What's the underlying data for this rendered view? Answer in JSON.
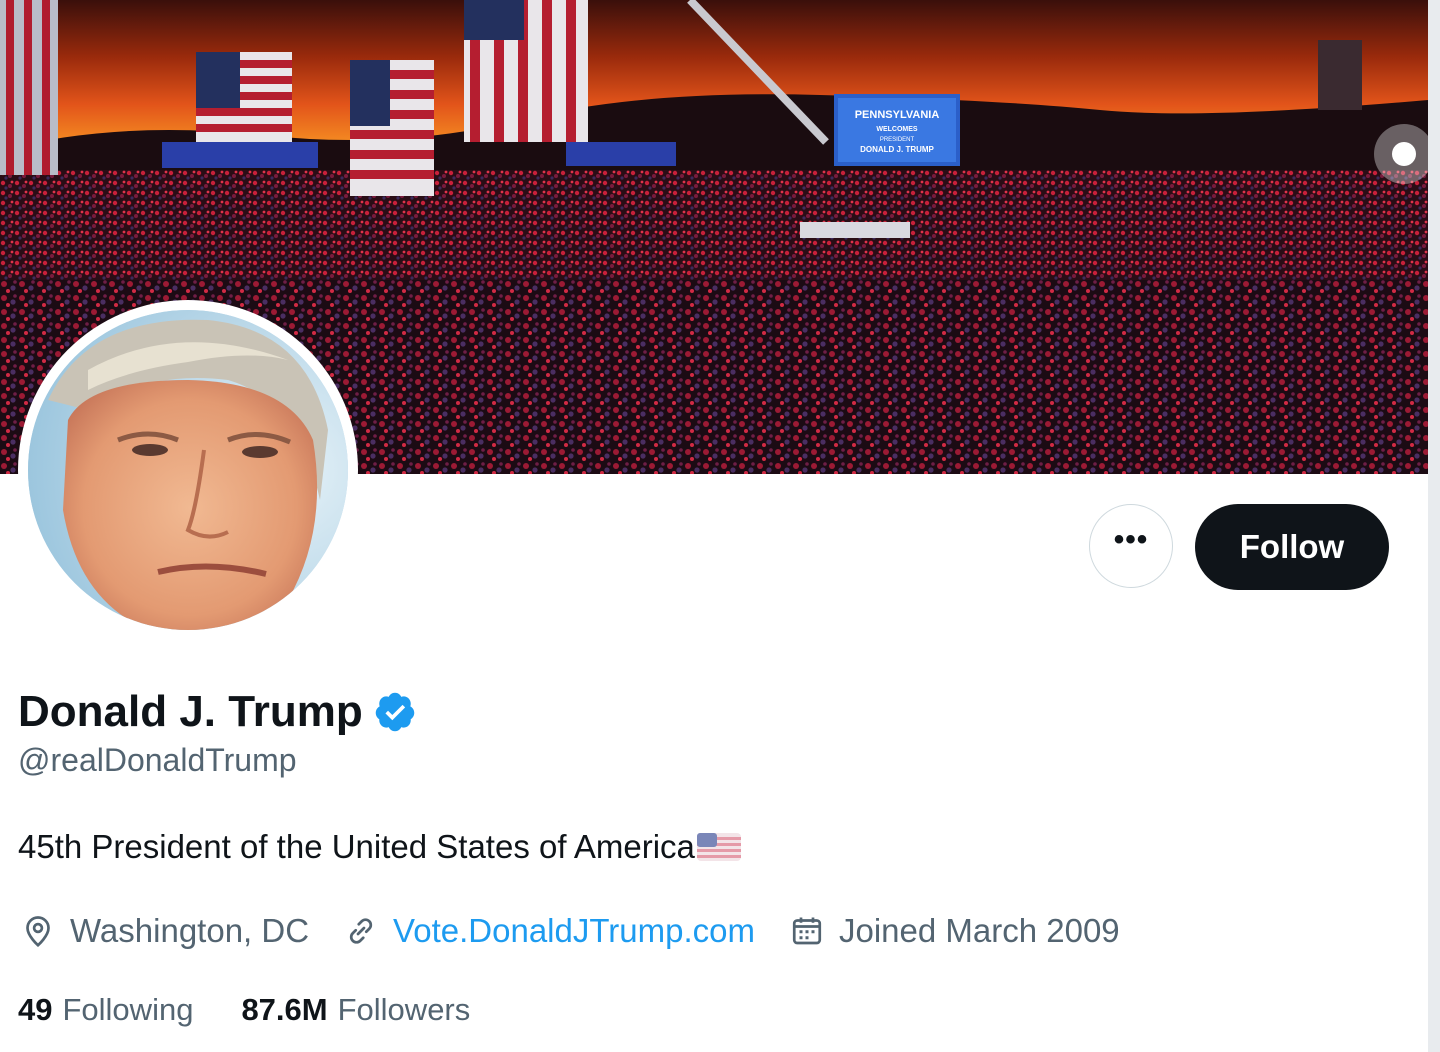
{
  "profile": {
    "display_name": "Donald J. Trump",
    "handle": "@realDonaldTrump",
    "bio": "45th President of the United States of America",
    "bio_emoji": "us-flag-emoji",
    "location": "Washington, DC",
    "website": "Vote.DonaldJTrump.com",
    "joined": "Joined March 2009",
    "verified": true
  },
  "banner": {
    "signs": [
      "PENNSYLVANIA",
      "WELCOMES",
      "PRESIDENT",
      "DONALD J. TRUMP"
    ]
  },
  "actions": {
    "more_label": "•••",
    "follow_label": "Follow"
  },
  "stats": {
    "following_count": "49",
    "following_label": "Following",
    "followers_count": "87.6M",
    "followers_label": "Followers"
  },
  "icons": {
    "location": "location-pin-icon",
    "link": "link-icon",
    "calendar": "calendar-icon",
    "verified": "verified-badge-icon"
  },
  "colors": {
    "text_primary": "#0f1419",
    "text_secondary": "#536471",
    "link": "#1d9bf0",
    "verified": "#1d9bf0",
    "follow_bg": "#0f1419"
  }
}
